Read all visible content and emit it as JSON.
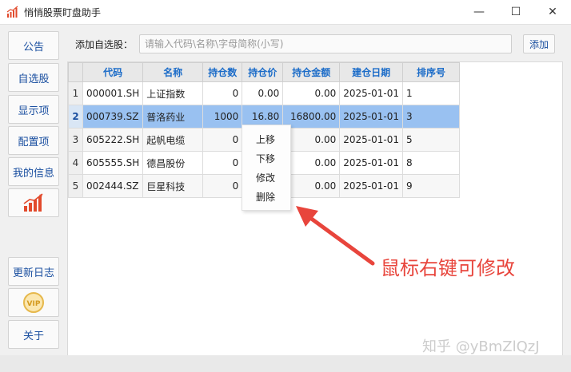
{
  "window": {
    "title": "悄悄股票盯盘助手",
    "minimize": "—",
    "maximize": "☐",
    "close": "✕"
  },
  "sidebar": {
    "items": [
      {
        "label": "公告"
      },
      {
        "label": "自选股"
      },
      {
        "label": "显示项"
      },
      {
        "label": "配置项"
      },
      {
        "label": "我的信息"
      }
    ],
    "chart_icon": "chart-bars-icon",
    "update_log": "更新日志",
    "vip": "VIP",
    "about": "关于"
  },
  "topbar": {
    "label": "添加自选股：",
    "placeholder": "请输入代码\\名称\\字母简称(小写)",
    "add_button": "添加"
  },
  "table": {
    "headers": [
      "代码",
      "名称",
      "持仓数",
      "持仓价",
      "持仓金额",
      "建仓日期",
      "排序号"
    ],
    "rows": [
      {
        "index": "1",
        "cells": [
          "000001.SH",
          "上证指数",
          "0",
          "0.00",
          "0.00",
          "2025-01-01",
          "1"
        ]
      },
      {
        "index": "2",
        "cells": [
          "000739.SZ",
          "普洛药业",
          "1000",
          "16.80",
          "16800.00",
          "2025-01-01",
          "3"
        ]
      },
      {
        "index": "3",
        "cells": [
          "605222.SH",
          "起帆电缆",
          "0",
          "",
          "0.00",
          "2025-01-01",
          "5"
        ]
      },
      {
        "index": "4",
        "cells": [
          "605555.SH",
          "德昌股份",
          "0",
          "",
          "0.00",
          "2025-01-01",
          "8"
        ]
      },
      {
        "index": "5",
        "cells": [
          "002444.SZ",
          "巨星科技",
          "0",
          "",
          "0.00",
          "2025-01-01",
          "9"
        ]
      }
    ],
    "selected_row": 1
  },
  "context_menu": {
    "items": [
      "上移",
      "下移",
      "修改",
      "删除"
    ]
  },
  "annotation": {
    "text": "鼠标右键可修改",
    "color": "#e8453c"
  },
  "watermark": "知乎 @yBmZlQzJ",
  "colors": {
    "header_text": "#1a6bc8",
    "selection": "#99c1f1",
    "accent_red": "#e24a2c"
  }
}
